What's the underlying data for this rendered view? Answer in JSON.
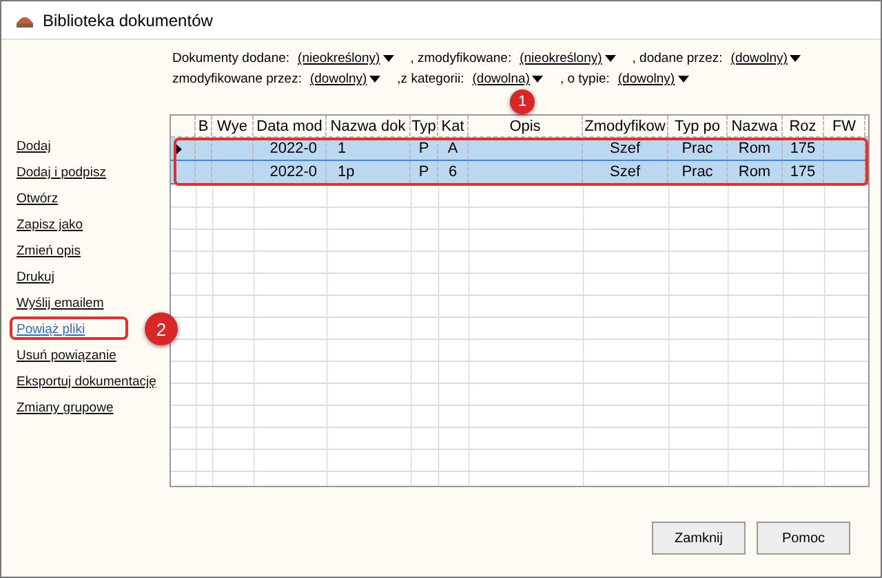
{
  "window": {
    "title": "Biblioteka dokumentów"
  },
  "filters": [
    [
      {
        "label": "Dokumenty dodane:",
        "value": "(nieokreślony)"
      },
      {
        "label": ", zmodyfikowane:",
        "value": "(nieokreślony)"
      },
      {
        "label": ", dodane przez:",
        "value": "(dowolny)"
      }
    ],
    [
      {
        "label": "zmodyfikowane przez:",
        "value": "(dowolny)"
      },
      {
        "label": ",z kategorii:",
        "value": "(dowolna)"
      },
      {
        "label": ", o typie:",
        "value": "(dowolny)"
      }
    ]
  ],
  "actions": [
    {
      "label": "Dodaj",
      "selected": false
    },
    {
      "label": "Dodaj i podpisz",
      "selected": false
    },
    {
      "label": "Otwórz",
      "selected": false
    },
    {
      "label": "Zapisz jako",
      "selected": false
    },
    {
      "label": "Zmień opis",
      "selected": false
    },
    {
      "label": "Drukuj",
      "selected": false
    },
    {
      "label": "Wyślij emailem",
      "selected": false
    },
    {
      "label": "Powiąż pliki",
      "selected": true
    },
    {
      "label": "Usuń powiązanie",
      "selected": false
    },
    {
      "label": "Eksportuj dokumentację",
      "selected": false
    },
    {
      "label": "Zmiany grupowe",
      "selected": false
    }
  ],
  "table": {
    "columns": [
      "B",
      "Wye",
      "Data mod",
      "Nazwa dok",
      "Typ",
      "Kat",
      "Opis",
      "Zmodyfikow",
      "Typ po",
      "Nazwa",
      "Roz",
      "FW"
    ],
    "rows": [
      {
        "current": true,
        "selected": true,
        "cells": [
          "",
          "",
          "2022-0",
          "1",
          "P",
          "A",
          "",
          "Szef",
          "Prac",
          "Rom",
          "175",
          ""
        ]
      },
      {
        "current": false,
        "selected": true,
        "cells": [
          "",
          "",
          "2022-0",
          "1p",
          "P",
          "6",
          "",
          "Szef",
          "Prac",
          "Rom",
          "175",
          ""
        ]
      }
    ]
  },
  "callouts": [
    "1",
    "2"
  ],
  "buttons": [
    "Zamknij",
    "Pomoc"
  ]
}
